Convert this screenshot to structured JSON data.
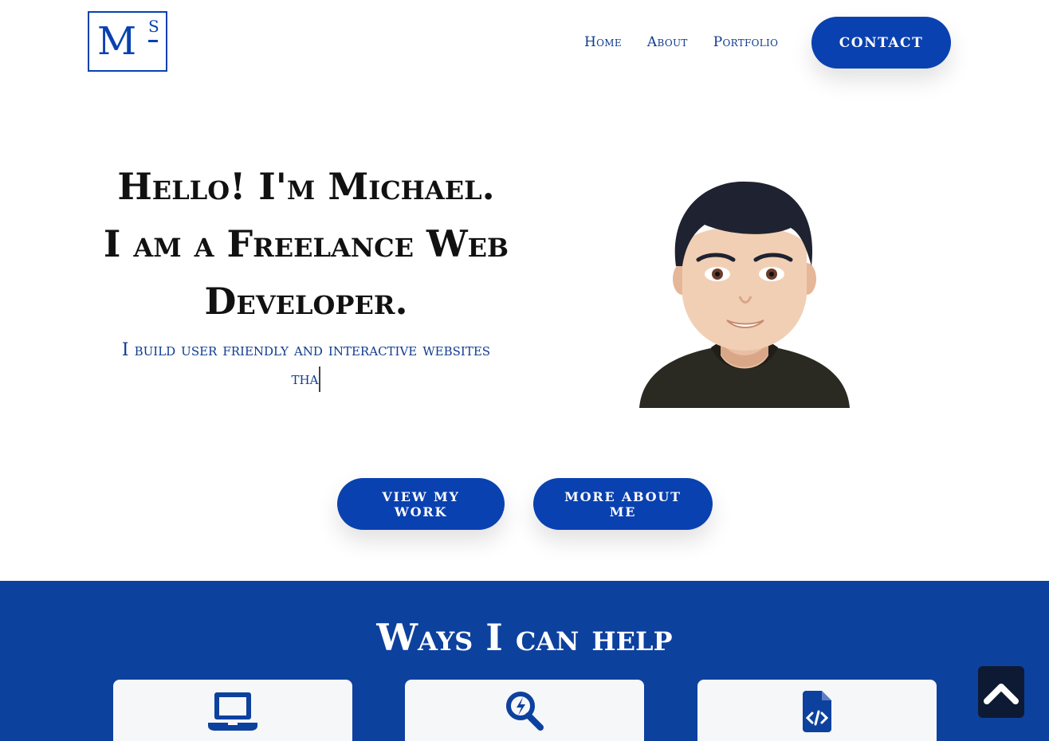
{
  "header": {
    "logo": {
      "main_letter": "M",
      "superscript": "S"
    },
    "nav": [
      {
        "label": "Home"
      },
      {
        "label": "About"
      },
      {
        "label": "Portfolio"
      }
    ],
    "contact_label": "CONTACT"
  },
  "hero": {
    "title_line1": "Hello! I'm Michael.",
    "title_line2": "I am a Freelance Web",
    "title_line3": "Developer.",
    "subtitle_line1": "I build user friendly and interactive websites",
    "subtitle_line2": "tha",
    "avatar_icon": "avatar-illustration",
    "buttons": [
      {
        "label": "VIEW MY WORK"
      },
      {
        "label": "MORE ABOUT ME"
      }
    ]
  },
  "services": {
    "title": "Ways I can help",
    "cards": [
      {
        "icon": "laptop-icon"
      },
      {
        "icon": "search-speed-icon"
      },
      {
        "icon": "code-file-icon"
      }
    ]
  },
  "scroll_top_icon": "chevron-up-icon",
  "colors": {
    "brand_blue": "#0a41b0",
    "section_blue": "#0d419e",
    "dark_button": "#0e1a33",
    "card_bg": "#f6f7f9"
  }
}
